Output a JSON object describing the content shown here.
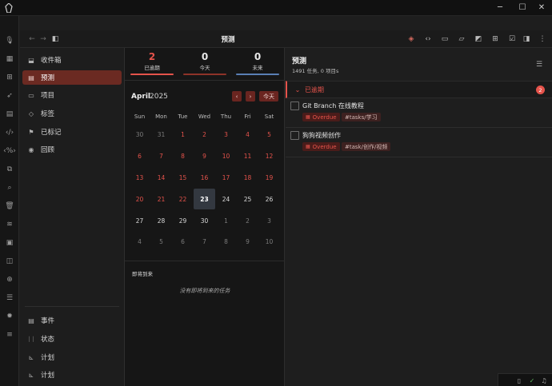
{
  "titlebar": {
    "minimize": "─",
    "maximize": "☐",
    "close": "✕"
  },
  "view": {
    "title": "预测"
  },
  "sidebar": {
    "items": [
      {
        "label": "收件箱",
        "icon": "inbox-icon"
      },
      {
        "label": "预测",
        "icon": "calendar-icon"
      },
      {
        "label": "项目",
        "icon": "folder-icon"
      },
      {
        "label": "标签",
        "icon": "tag-icon"
      },
      {
        "label": "已标记",
        "icon": "flag-icon"
      },
      {
        "label": "回顾",
        "icon": "eye-icon"
      }
    ],
    "bottom_items": [
      {
        "label": "事件",
        "icon": "calendar-icon"
      },
      {
        "label": "状态",
        "icon": "status-icon"
      },
      {
        "label": "计划",
        "icon": "chart-icon"
      },
      {
        "label": "计划",
        "icon": "chart-icon"
      }
    ]
  },
  "stats": [
    {
      "count": "2",
      "label": "已逾期",
      "color": "#e5534b"
    },
    {
      "count": "0",
      "label": "今天",
      "color": "#a33d33"
    },
    {
      "count": "0",
      "label": "未来",
      "color": "#5a7fb5"
    }
  ],
  "calendar": {
    "month": "April",
    "year": "2025",
    "today_button": "今天",
    "prev": "‹",
    "next": "›",
    "weekdays": [
      "Sun",
      "Mon",
      "Tue",
      "Wed",
      "Thu",
      "Fri",
      "Sat"
    ],
    "weeks": [
      [
        "30",
        "31",
        "1",
        "2",
        "3",
        "4",
        "5"
      ],
      [
        "6",
        "7",
        "8",
        "9",
        "10",
        "11",
        "12"
      ],
      [
        "13",
        "14",
        "15",
        "16",
        "17",
        "18",
        "19"
      ],
      [
        "20",
        "21",
        "22",
        "23",
        "24",
        "25",
        "26"
      ],
      [
        "27",
        "28",
        "29",
        "30",
        "1",
        "2",
        "3"
      ],
      [
        "4",
        "5",
        "6",
        "7",
        "8",
        "9",
        "10"
      ]
    ]
  },
  "upcoming": {
    "title": "即将到来",
    "empty": "没有即将到来的任务"
  },
  "forecast": {
    "title": "预测",
    "summary": "1491 任务, 0 项目s",
    "section_label": "已逾期",
    "section_count": "2",
    "tasks": [
      {
        "title": "Git Branch 在线教程",
        "status": "Overdue",
        "tag": "#tasks/学习"
      },
      {
        "title": "狗狗视频创作",
        "status": "Overdue",
        "tag": "#task/创作/视频"
      }
    ]
  },
  "colors": {
    "accent": "#e5534b",
    "active_nav": "#6b2a22"
  }
}
